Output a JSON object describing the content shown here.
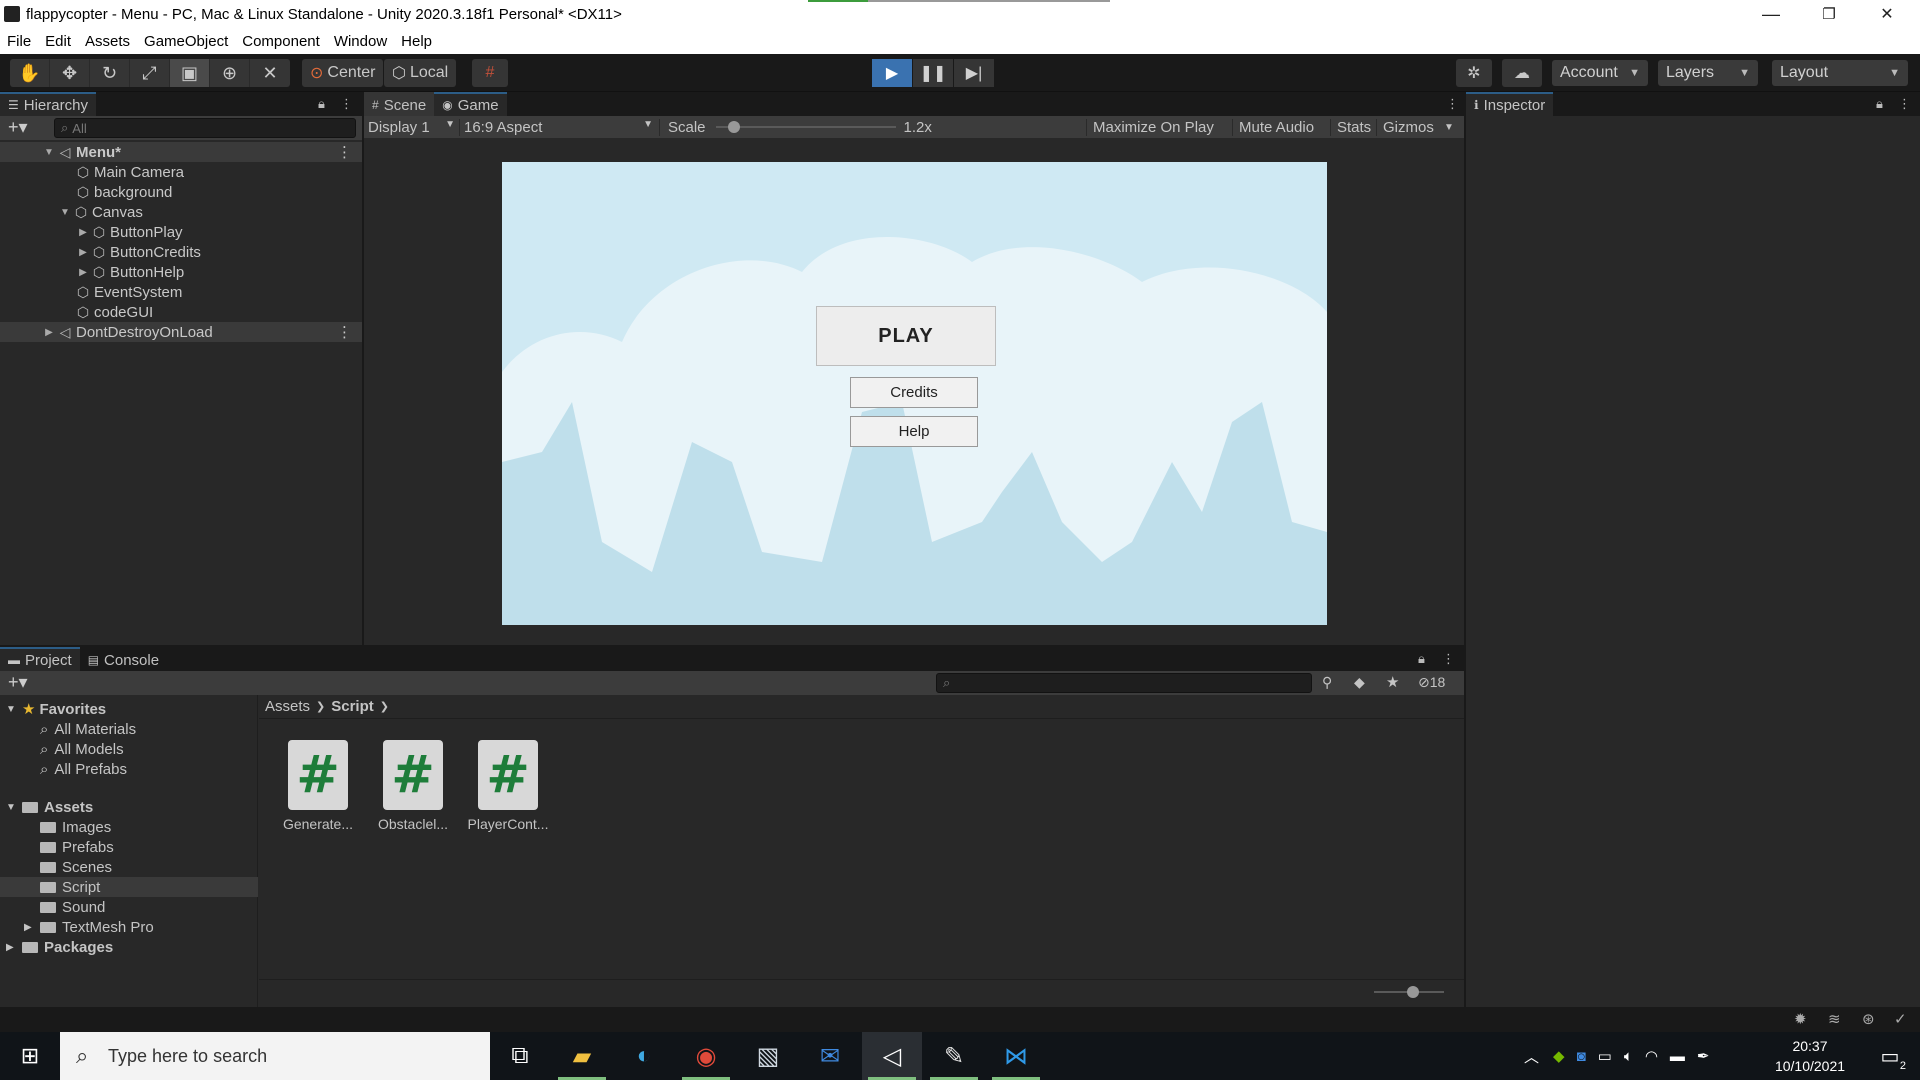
{
  "window": {
    "title": "flappycopter - Menu - PC, Mac & Linux Standalone - Unity 2020.3.18f1 Personal* <DX11>",
    "minimize": "—",
    "restore": "❐",
    "close": "✕"
  },
  "menu": [
    "File",
    "Edit",
    "Assets",
    "GameObject",
    "Component",
    "Window",
    "Help"
  ],
  "toolbar": {
    "pivot": "Center",
    "space": "Local",
    "account": "Account",
    "layers": "Layers",
    "layout": "Layout"
  },
  "hierarchy": {
    "tab": "Hierarchy",
    "search_placeholder": "All",
    "rows": [
      "Menu*",
      "Main Camera",
      "background",
      "Canvas",
      "ButtonPlay",
      "ButtonCredits",
      "ButtonHelp",
      "EventSystem",
      "codeGUI",
      "DontDestroyOnLoad"
    ]
  },
  "game": {
    "tab_scene": "Scene",
    "tab_game": "Game",
    "display": "Display 1",
    "aspect": "16:9 Aspect",
    "scale_label": "Scale",
    "scale_value": "1.2x",
    "maximize": "Maximize On Play",
    "mute": "Mute Audio",
    "stats": "Stats",
    "gizmos": "Gizmos",
    "play_button": "PLAY",
    "credits_button": "Credits",
    "help_button": "Help",
    "sky_color": "#cfe9f3",
    "cloud_color": "#e8f4f9",
    "mountain_color": "#bfdfeb"
  },
  "inspector": {
    "tab": "Inspector"
  },
  "project": {
    "tab_project": "Project",
    "tab_console": "Console",
    "hidden_count": "18",
    "favorites": "Favorites",
    "fav_items": [
      "All Materials",
      "All Models",
      "All Prefabs"
    ],
    "assets": "Assets",
    "asset_folders": [
      "Images",
      "Prefabs",
      "Scenes",
      "Script",
      "Sound",
      "TextMesh Pro"
    ],
    "packages": "Packages",
    "breadcrumb": [
      "Assets",
      "Script"
    ],
    "files": [
      "Generate...",
      "Obstaclel...",
      "PlayerCont..."
    ]
  },
  "taskbar": {
    "search_placeholder": "Type here to search",
    "time": "20:37",
    "date": "10/10/2021",
    "notif_count": "2"
  },
  "colors": {
    "accent": "#3a72b0",
    "script_green": "#1e7d3a"
  }
}
